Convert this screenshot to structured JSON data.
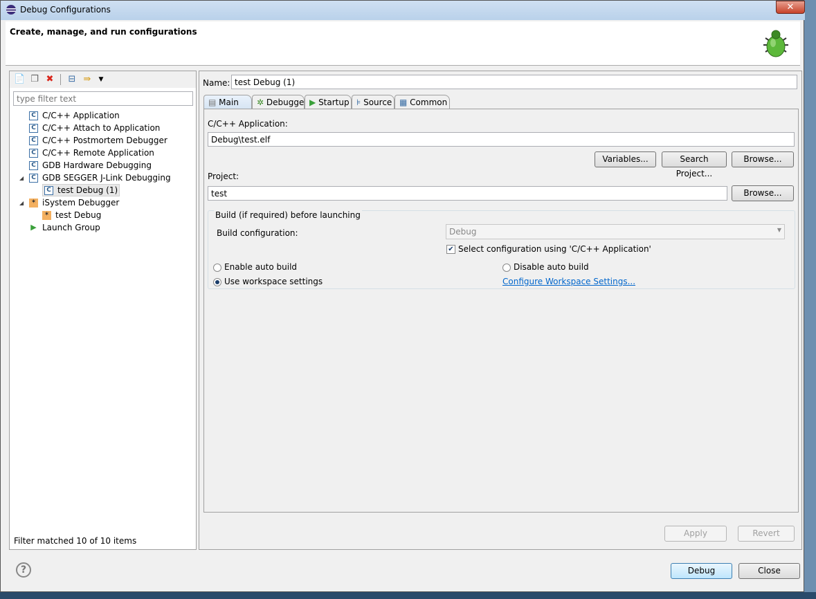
{
  "window": {
    "title": "Debug Configurations",
    "close": "✕"
  },
  "header": {
    "title": "Create, manage, and run configurations"
  },
  "left": {
    "filter_placeholder": "type filter text",
    "toolbar": [
      "new-config",
      "duplicate",
      "delete",
      "collapse-all",
      "filter"
    ],
    "tree": [
      {
        "label": "C/C++ Application",
        "icon": "c",
        "level": 0
      },
      {
        "label": "C/C++ Attach to Application",
        "icon": "c",
        "level": 0
      },
      {
        "label": "C/C++ Postmortem Debugger",
        "icon": "c",
        "level": 0
      },
      {
        "label": "C/C++ Remote Application",
        "icon": "c",
        "level": 0
      },
      {
        "label": "GDB Hardware Debugging",
        "icon": "c",
        "level": 0
      },
      {
        "label": "GDB SEGGER J-Link Debugging",
        "icon": "c",
        "level": 0,
        "expanded": true
      },
      {
        "label": "test Debug (1)",
        "icon": "c",
        "level": 1,
        "selected": true
      },
      {
        "label": "iSystem Debugger",
        "icon": "isystem",
        "level": 0,
        "expanded": true
      },
      {
        "label": "test Debug",
        "icon": "isystem",
        "level": 1
      },
      {
        "label": "Launch Group",
        "icon": "launch",
        "level": 0
      }
    ],
    "status": "Filter matched 10 of 10 items"
  },
  "right": {
    "name_label": "Name:",
    "name_value": "test Debug (1)",
    "tabs": [
      "Main",
      "Debugger",
      "Startup",
      "Source",
      "Common"
    ],
    "app_label": "C/C++ Application:",
    "app_value": "Debug\\test.elf",
    "variables": "Variables...",
    "search_project": "Search Project...",
    "browse": "Browse...",
    "project_label": "Project:",
    "project_value": "test",
    "build_group": "Build (if required) before launching",
    "build_config_label": "Build configuration:",
    "build_config_value": "Debug",
    "select_config": "Select configuration using 'C/C++ Application'",
    "enable_auto": "Enable auto build",
    "disable_auto": "Disable auto build",
    "use_workspace": "Use workspace settings",
    "configure_link": "Configure Workspace Settings...",
    "apply": "Apply",
    "revert": "Revert"
  },
  "footer": {
    "help": "?",
    "debug": "Debug",
    "close": "Close"
  }
}
